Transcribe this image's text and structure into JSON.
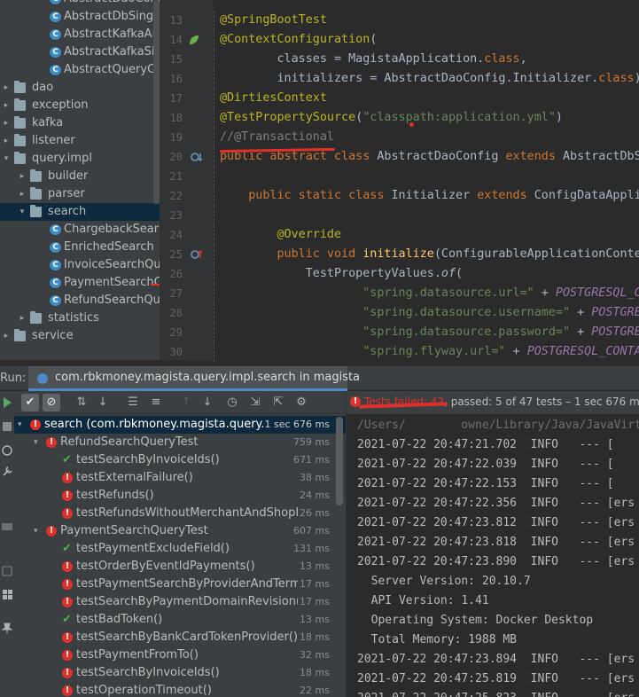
{
  "project_tree": {
    "items": [
      {
        "label": "AbstractDaoConfig",
        "type": "class",
        "depth": 3
      },
      {
        "label": "AbstractDbSingleto",
        "type": "class",
        "depth": 3
      },
      {
        "label": "AbstractKafkaAndD",
        "type": "class",
        "depth": 3
      },
      {
        "label": "AbstractKafkaSingl",
        "type": "class",
        "depth": 3
      },
      {
        "label": "AbstractQueryConf",
        "type": "class",
        "depth": 3
      },
      {
        "label": "dao",
        "type": "folder",
        "depth": 1,
        "expanded": false
      },
      {
        "label": "exception",
        "type": "folder",
        "depth": 1,
        "expanded": false
      },
      {
        "label": "kafka",
        "type": "folder",
        "depth": 1,
        "expanded": false
      },
      {
        "label": "listener",
        "type": "folder",
        "depth": 1,
        "expanded": false
      },
      {
        "label": "query.impl",
        "type": "folder",
        "depth": 1,
        "expanded": true
      },
      {
        "label": "builder",
        "type": "folder",
        "depth": 2,
        "expanded": false
      },
      {
        "label": "parser",
        "type": "folder",
        "depth": 2,
        "expanded": false
      },
      {
        "label": "search",
        "type": "folder",
        "depth": 2,
        "expanded": true,
        "selected": true
      },
      {
        "label": "ChargebackSear",
        "type": "class",
        "depth": 3
      },
      {
        "label": "EnrichedSearch",
        "type": "class",
        "depth": 3
      },
      {
        "label": "InvoiceSearchQu",
        "type": "class",
        "depth": 3
      },
      {
        "label": "PaymentSearchQ",
        "type": "class",
        "depth": 3
      },
      {
        "label": "RefundSearchQu",
        "type": "class",
        "depth": 3
      },
      {
        "label": "statistics",
        "type": "folder",
        "depth": 2,
        "expanded": false
      },
      {
        "label": "service",
        "type": "folder",
        "depth": 1,
        "expanded": false
      }
    ]
  },
  "editor": {
    "lines": [
      {
        "n": "13",
        "html": "<span class='ann'>@SpringBootTest</span>"
      },
      {
        "n": "14",
        "html": "<span class='ann'>@ContextConfiguration</span>("
      },
      {
        "n": "15",
        "html": "        classes = MagistaApplication.<span class='kw'>class</span>,"
      },
      {
        "n": "16",
        "html": "        initializers = AbstractDaoConfig.Initializer.<span class='kw'>class</span>)"
      },
      {
        "n": "17",
        "html": "<span class='ann'>@DirtiesContext</span>"
      },
      {
        "n": "18",
        "html": "<span class='ann'>@TestPropertySource</span>(<span class='str'>\"classpath:application.yml\"</span>)"
      },
      {
        "n": "19",
        "html": "<span class='cmt'>//@Transactional</span>"
      },
      {
        "n": "20",
        "html": "<span class='kw'>public abstract class</span> AbstractDaoConfig <span class='kw'>extends</span> AbstractDbS"
      },
      {
        "n": "21",
        "html": ""
      },
      {
        "n": "22",
        "html": "    <span class='kw'>public static class</span> Initializer <span class='kw'>extends</span> ConfigDataAppli"
      },
      {
        "n": "23",
        "html": ""
      },
      {
        "n": "24",
        "html": "        <span class='ann'>@Override</span>"
      },
      {
        "n": "25",
        "html": "        <span class='kw'>public void</span> <span class='fn'>initialize</span>(ConfigurableApplicationConte"
      },
      {
        "n": "26",
        "html": "            TestPropertyValues.<span class='it'>of</span>("
      },
      {
        "n": "27",
        "html": "                    <span class='str'>\"spring.datasource.url=\"</span> + <span class='cst'>POSTGRESQL_C</span>"
      },
      {
        "n": "28",
        "html": "                    <span class='str'>\"spring.datasource.username=\"</span> + <span class='cst'>POSTGRES</span>"
      },
      {
        "n": "29",
        "html": "                    <span class='str'>\"spring.datasource.password=\"</span> + <span class='cst'>POSTGRE</span>"
      },
      {
        "n": "30",
        "html": "                    <span class='str'>\"spring.flyway.url=\"</span> + <span class='cst'>POSTGRESQL_CONTA</span>"
      }
    ]
  },
  "run_panel": {
    "title": "Run:",
    "tab_label": "com.rbkmoney.magista.query.impl.search in magista",
    "status": {
      "failed_text": "Tests failed: 42",
      "rest_text": ", passed: 5 of 47 tests – 1 sec 676 ms"
    },
    "tests": [
      {
        "name": "search (com.rbkmoney.magista.query.ir",
        "time": "1 sec 676 ms",
        "status": "fail",
        "depth": 0,
        "selected": true,
        "group": true
      },
      {
        "name": "RefundSearchQueryTest",
        "time": "759 ms",
        "status": "fail",
        "depth": 1,
        "group": true
      },
      {
        "name": "testSearchByInvoiceIds()",
        "time": "671 ms",
        "status": "pass",
        "depth": 2
      },
      {
        "name": "testExternalFailure()",
        "time": "38 ms",
        "status": "fail",
        "depth": 2
      },
      {
        "name": "testRefunds()",
        "time": "24 ms",
        "status": "fail",
        "depth": 2
      },
      {
        "name": "testRefundsWithoutMerchantAndShopIc",
        "time": "26 ms",
        "status": "fail",
        "depth": 2
      },
      {
        "name": "PaymentSearchQueryTest",
        "time": "607 ms",
        "status": "fail",
        "depth": 1,
        "group": true
      },
      {
        "name": "testPaymentExcludeField()",
        "time": "131 ms",
        "status": "pass",
        "depth": 2
      },
      {
        "name": "testOrderByEventIdPayments()",
        "time": "13 ms",
        "status": "fail",
        "depth": 2
      },
      {
        "name": "testPaymentSearchByProviderAndTermi",
        "time": "17 ms",
        "status": "fail",
        "depth": 2
      },
      {
        "name": "testSearchByPaymentDomainRevision()",
        "time": "17 ms",
        "status": "fail",
        "depth": 2
      },
      {
        "name": "testBadToken()",
        "time": "13 ms",
        "status": "pass",
        "depth": 2
      },
      {
        "name": "testSearchByBankCardTokenProvider()",
        "time": "18 ms",
        "status": "fail",
        "depth": 2
      },
      {
        "name": "testPaymentFromTo()",
        "time": "32 ms",
        "status": "fail",
        "depth": 2
      },
      {
        "name": "testSearchByInvoiceIds()",
        "time": "18 ms",
        "status": "fail",
        "depth": 2
      },
      {
        "name": "testOperationTimeout()",
        "time": "22 ms",
        "status": "fail",
        "depth": 2
      }
    ],
    "console": [
      {
        "text": "/Users/        owne/Library/Java/JavaVirtua",
        "faded": true
      },
      {
        "text": "2021-07-22 20:47:21.702  INFO   --- ["
      },
      {
        "text": "2021-07-22 20:47:22.039  INFO   --- ["
      },
      {
        "text": "2021-07-22 20:47:22.153  INFO   --- ["
      },
      {
        "text": "2021-07-22 20:47:22.356  INFO   --- [ers"
      },
      {
        "text": "2021-07-22 20:47:23.812  INFO   --- [ers"
      },
      {
        "text": "2021-07-22 20:47:23.818  INFO   --- [ers"
      },
      {
        "text": "2021-07-22 20:47:23.890  INFO   --- [ers"
      },
      {
        "text": "  Server Version: 20.10.7"
      },
      {
        "text": "  API Version: 1.41"
      },
      {
        "text": "  Operating System: Docker Desktop"
      },
      {
        "text": "  Total Memory: 1988 MB"
      },
      {
        "text": "2021-07-22 20:47:23.894  INFO   --- [ers"
      },
      {
        "text": "2021-07-22 20:47:25.819  INFO   --- [ers"
      },
      {
        "text": "2021-07-22 20:47:25.823  INFO   --- [ers"
      }
    ]
  },
  "colors": {
    "accent": "#4a88c7",
    "fail": "#e0302a",
    "pass": "#4caf50"
  }
}
